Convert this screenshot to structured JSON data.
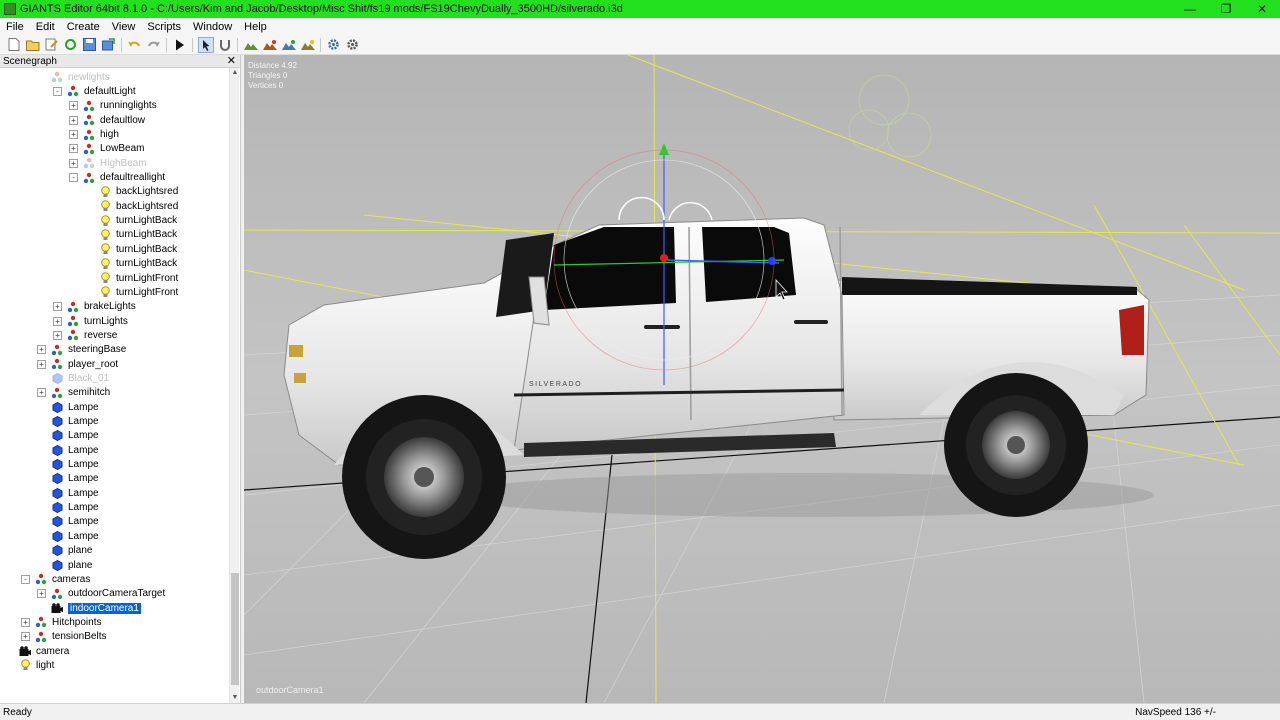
{
  "window": {
    "title": "GIANTS Editor 64bit 8.1.0 - C:/Users/Kim and Jacob/Desktop/Misc Shit/fs19 mods/FS19ChevyDually_3500HD/silverado.i3d"
  },
  "menu": [
    "File",
    "Edit",
    "Create",
    "View",
    "Scripts",
    "Window",
    "Help"
  ],
  "scenegraph": {
    "title": "Scenegraph",
    "nodes": [
      {
        "label": "newlights",
        "indent": 3,
        "exp": "",
        "icon": "transform-group-icon",
        "dim": true
      },
      {
        "label": "defaultLight",
        "indent": 4,
        "exp": "-",
        "icon": "transform-group-icon"
      },
      {
        "label": "runninglights",
        "indent": 5,
        "exp": "+",
        "icon": "transform-group-icon"
      },
      {
        "label": "defaultlow",
        "indent": 5,
        "exp": "+",
        "icon": "transform-group-icon"
      },
      {
        "label": "high",
        "indent": 5,
        "exp": "+",
        "icon": "transform-group-icon"
      },
      {
        "label": "LowBeam",
        "indent": 5,
        "exp": "+",
        "icon": "transform-group-icon"
      },
      {
        "label": "HighBeam",
        "indent": 5,
        "exp": "+",
        "icon": "transform-group-icon",
        "dim": true
      },
      {
        "label": "defaultreallight",
        "indent": 5,
        "exp": "-",
        "icon": "transform-group-icon"
      },
      {
        "label": "backLightsred",
        "indent": 6,
        "exp": "",
        "icon": "light-bulb-icon"
      },
      {
        "label": "backLightsred",
        "indent": 6,
        "exp": "",
        "icon": "light-bulb-icon"
      },
      {
        "label": "turnLightBack",
        "indent": 6,
        "exp": "",
        "icon": "light-bulb-icon"
      },
      {
        "label": "turnLightBack",
        "indent": 6,
        "exp": "",
        "icon": "light-bulb-icon"
      },
      {
        "label": "turnLightBack",
        "indent": 6,
        "exp": "",
        "icon": "light-bulb-icon"
      },
      {
        "label": "turnLightBack",
        "indent": 6,
        "exp": "",
        "icon": "light-bulb-icon"
      },
      {
        "label": "turnLightFront",
        "indent": 6,
        "exp": "",
        "icon": "light-bulb-icon"
      },
      {
        "label": "turnLightFront",
        "indent": 6,
        "exp": "",
        "icon": "light-bulb-icon"
      },
      {
        "label": "brakeLights",
        "indent": 4,
        "exp": "+",
        "icon": "transform-group-icon"
      },
      {
        "label": "turnLights",
        "indent": 4,
        "exp": "+",
        "icon": "transform-group-icon"
      },
      {
        "label": "reverse",
        "indent": 4,
        "exp": "+",
        "icon": "transform-group-icon"
      },
      {
        "label": "steeringBase",
        "indent": 3,
        "exp": "+",
        "icon": "transform-group-icon"
      },
      {
        "label": "player_root",
        "indent": 3,
        "exp": "+",
        "icon": "transform-group-icon"
      },
      {
        "label": "Black_01",
        "indent": 3,
        "exp": "",
        "icon": "shape-icon",
        "dim": true
      },
      {
        "label": "semihitch",
        "indent": 3,
        "exp": "+",
        "icon": "transform-group-icon"
      },
      {
        "label": "Lampe",
        "indent": 3,
        "exp": "",
        "icon": "shape-icon"
      },
      {
        "label": "Lampe",
        "indent": 3,
        "exp": "",
        "icon": "shape-icon"
      },
      {
        "label": "Lampe",
        "indent": 3,
        "exp": "",
        "icon": "shape-icon"
      },
      {
        "label": "Lampe",
        "indent": 3,
        "exp": "",
        "icon": "shape-icon"
      },
      {
        "label": "Lampe",
        "indent": 3,
        "exp": "",
        "icon": "shape-icon"
      },
      {
        "label": "Lampe",
        "indent": 3,
        "exp": "",
        "icon": "shape-icon"
      },
      {
        "label": "Lampe",
        "indent": 3,
        "exp": "",
        "icon": "shape-icon"
      },
      {
        "label": "Lampe",
        "indent": 3,
        "exp": "",
        "icon": "shape-icon"
      },
      {
        "label": "Lampe",
        "indent": 3,
        "exp": "",
        "icon": "shape-icon"
      },
      {
        "label": "Lampe",
        "indent": 3,
        "exp": "",
        "icon": "shape-icon"
      },
      {
        "label": "plane",
        "indent": 3,
        "exp": "",
        "icon": "shape-icon"
      },
      {
        "label": "plane",
        "indent": 3,
        "exp": "",
        "icon": "shape-icon"
      },
      {
        "label": "cameras",
        "indent": 2,
        "exp": "-",
        "icon": "transform-group-icon"
      },
      {
        "label": "outdoorCameraTarget",
        "indent": 3,
        "exp": "+",
        "icon": "transform-group-icon"
      },
      {
        "label": "indoorCamera1",
        "indent": 3,
        "exp": "",
        "icon": "camera-icon",
        "selected": true
      },
      {
        "label": "Hitchpoints",
        "indent": 2,
        "exp": "+",
        "icon": "transform-group-icon"
      },
      {
        "label": "tensionBelts",
        "indent": 2,
        "exp": "+",
        "icon": "transform-group-icon"
      },
      {
        "label": "camera",
        "indent": 1,
        "exp": "",
        "icon": "camera-icon"
      },
      {
        "label": "light",
        "indent": 1,
        "exp": "",
        "icon": "light-bulb-icon"
      }
    ]
  },
  "viewport": {
    "stats": [
      "Distance 4.92",
      "Triangles 0",
      "Vertices 0"
    ],
    "camera_label": "outdoorCamera1",
    "vehicle_badge": "SILVERADO"
  },
  "status": {
    "left": "Ready",
    "right": "NavSpeed 136 +/-"
  },
  "colors": {
    "titlebar": "#22e01e",
    "selection": "#0a64d0",
    "viewport_bg": "#bcbcbc",
    "truck_body": "#e8e8e8"
  }
}
